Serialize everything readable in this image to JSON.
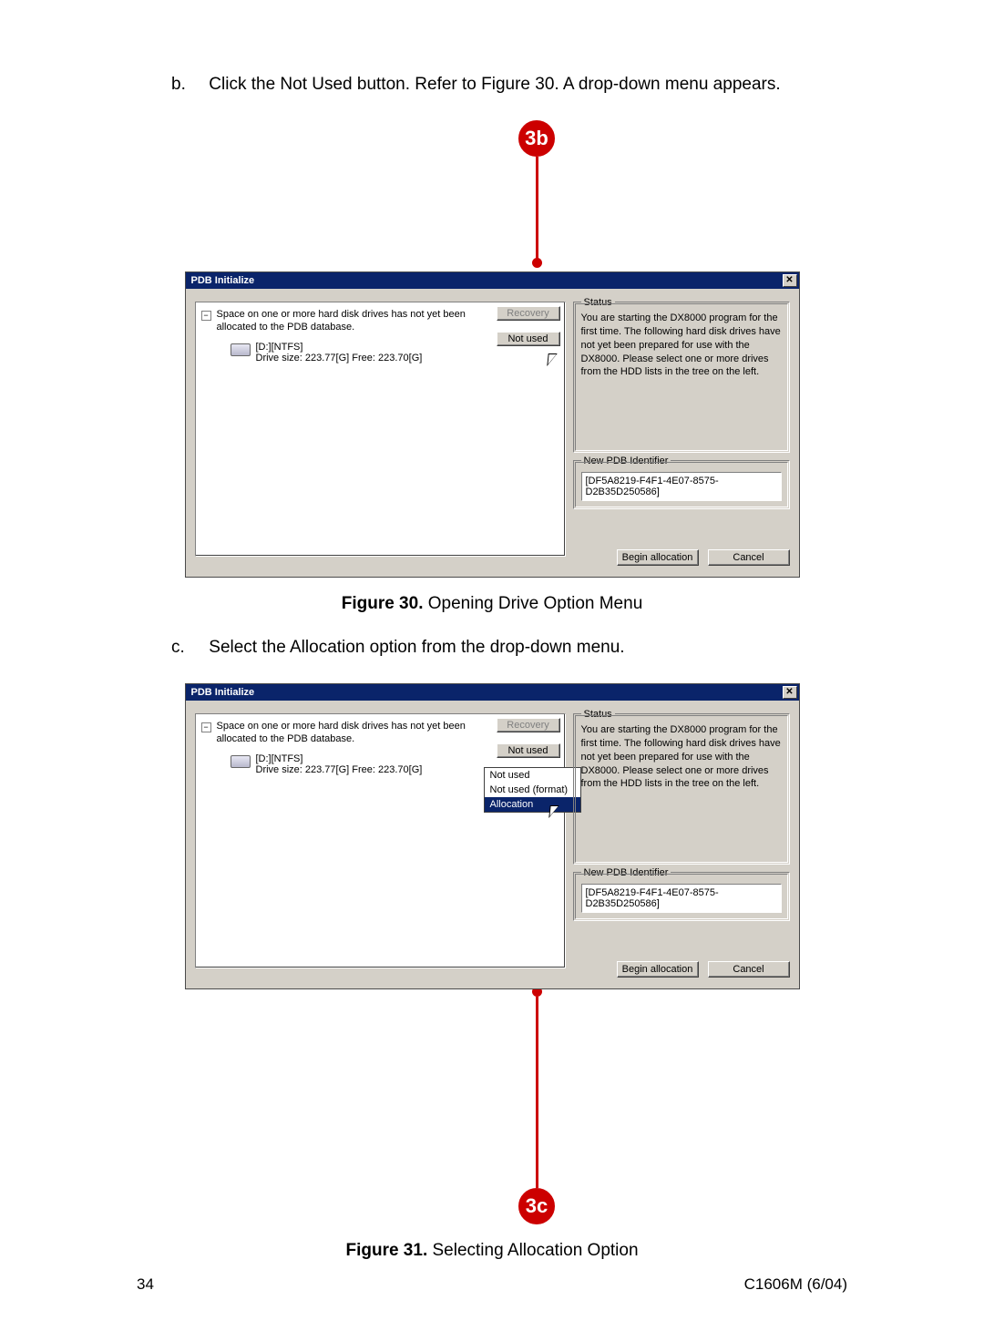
{
  "steps": {
    "b": {
      "letter": "b.",
      "text": "Click the Not Used button. Refer to Figure 30. A drop-down menu appears."
    },
    "c": {
      "letter": "c.",
      "text": "Select the Allocation option from the drop-down menu."
    }
  },
  "callouts": {
    "b": "3b",
    "c": "3c"
  },
  "captions": {
    "fig30_bold": "Figure 30.",
    "fig30_rest": " Opening Drive Option Menu",
    "fig31_bold": "Figure 31.",
    "fig31_rest": " Selecting Allocation Option"
  },
  "dialog": {
    "title": "PDB Initialize",
    "close_glyph": "✕",
    "tree": {
      "collapse_glyph": "−",
      "root_text": "Space on one or more hard disk drives has not yet been allocated to the PDB database.",
      "drive_label": "[D:][NTFS]",
      "drive_stats": "Drive size: 223.77[G] Free: 223.70[G]"
    },
    "buttons": {
      "recovery": "Recovery",
      "not_used": "Not used",
      "begin": "Begin allocation",
      "cancel": "Cancel"
    },
    "status": {
      "legend": "Status",
      "text": "You are starting the DX8000 program for the first time. The following hard disk drives have not yet been prepared for use with the DX8000. Please select one or more drives from the HDD lists in the tree on the left."
    },
    "pdb_id": {
      "legend": "New PDB Identifier",
      "value": "[DF5A8219-F4F1-4E07-8575-D2B35D250586]"
    },
    "dropdown": {
      "items": [
        "Not used",
        "Not used (format)",
        "Allocation"
      ],
      "selected_index": 2
    }
  },
  "footer": {
    "page": "34",
    "docid": "C1606M (6/04)"
  }
}
